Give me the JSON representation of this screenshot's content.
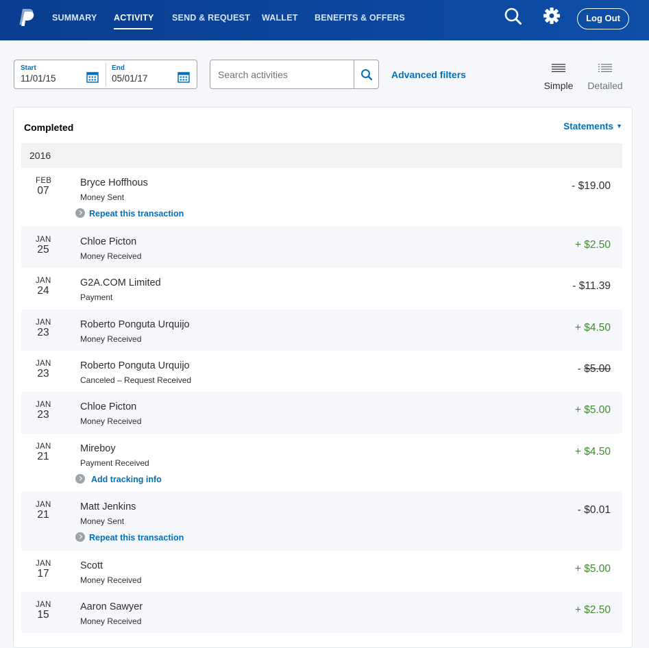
{
  "nav": {
    "items": [
      {
        "label": "SUMMARY"
      },
      {
        "label": "ACTIVITY"
      },
      {
        "label": "SEND & REQUEST"
      },
      {
        "label": "WALLET"
      },
      {
        "label": "BENEFITS & OFFERS"
      }
    ],
    "active": "ACTIVITY",
    "logout_label": "Log Out"
  },
  "filters": {
    "start_label": "Start",
    "start_value": "11/01/15",
    "end_label": "End",
    "end_value": "05/01/17",
    "search_placeholder": "Search activities",
    "advanced_label": "Advanced filters",
    "views": [
      {
        "label": "Simple",
        "selected": true
      },
      {
        "label": "Detailed",
        "selected": false
      }
    ]
  },
  "activity": {
    "heading": "Completed",
    "statements_label": "Statements",
    "year": "2016",
    "transactions": [
      {
        "month": "FEB",
        "day": "07",
        "name": "Bryce Hoffhous",
        "type": "Money Sent",
        "amount": "- $19.00",
        "direction": "debit",
        "action": "Repeat this transaction"
      },
      {
        "month": "JAN",
        "day": "25",
        "name": "Chloe Picton",
        "type": "Money Received",
        "amount": "+ $2.50",
        "direction": "credit",
        "action": ""
      },
      {
        "month": "JAN",
        "day": "24",
        "name": "G2A.COM Limited",
        "type": "Payment",
        "amount": "- $11.39",
        "direction": "debit",
        "action": ""
      },
      {
        "month": "JAN",
        "day": "23",
        "name": "Roberto Ponguta Urquijo",
        "type": "Money Received",
        "amount": "+ $4.50",
        "direction": "credit",
        "action": ""
      },
      {
        "month": "JAN",
        "day": "23",
        "name": "Roberto Ponguta Urquijo",
        "type": "Canceled – Request Received",
        "amount_sign": "- ",
        "amount_value": "$5.00",
        "direction": "canceled",
        "action": ""
      },
      {
        "month": "JAN",
        "day": "23",
        "name": "Chloe Picton",
        "type": "Money Received",
        "amount": "+ $5.00",
        "direction": "credit",
        "action": ""
      },
      {
        "month": "JAN",
        "day": "21",
        "name": "Mireboy",
        "type": "Payment Received",
        "amount": "+ $4.50",
        "direction": "credit",
        "action": "Add tracking info"
      },
      {
        "month": "JAN",
        "day": "21",
        "name": "Matt Jenkins",
        "type": "Money Sent",
        "amount": "- $0.01",
        "direction": "debit",
        "action": "Repeat this transaction"
      },
      {
        "month": "JAN",
        "day": "17",
        "name": "Scott",
        "type": "Money Received",
        "amount": "+ $5.00",
        "direction": "credit",
        "action": ""
      },
      {
        "month": "JAN",
        "day": "15",
        "name": "Aaron Sawyer",
        "type": "Money Received",
        "amount": "+ $2.50",
        "direction": "credit",
        "action": ""
      }
    ]
  },
  "colors": {
    "header": "#0e4fa8",
    "link": "#0070ba",
    "credit": "#3e8e2c"
  },
  "icons": [
    "paypal-logo",
    "search-icon",
    "gear-icon",
    "calendar-icon",
    "list-icon"
  ]
}
